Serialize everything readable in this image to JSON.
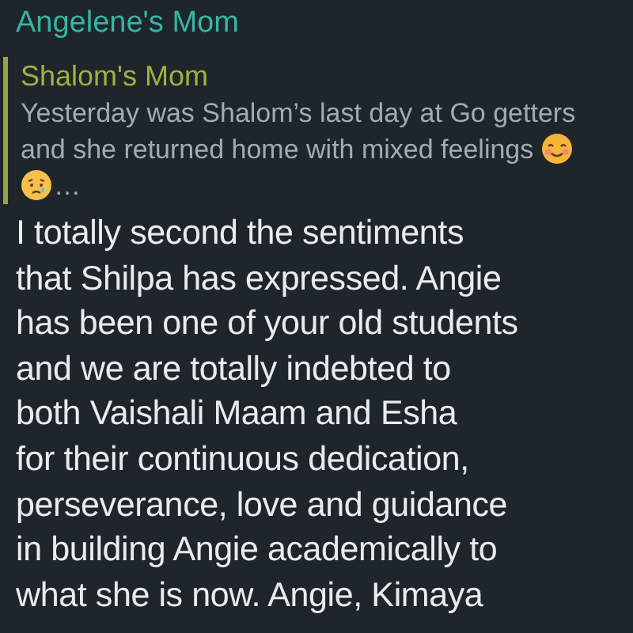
{
  "message": {
    "sender": "Angelene's Mom",
    "reply": {
      "sender": "Shalom's Mom",
      "text": "Yesterday was Shalom’s last day at Go getters and she returned home with mixed feelings",
      "ellipsis": "…"
    },
    "text": "I totally second the sentiments\nthat Shilpa has expressed.  Angie\nhas been one of your old students\nand we are totally indebted to\nboth Vaishali Maam and Esha\nfor their continuous dedication,\nperseverance, love and guidance\nin building Angie academically to\nwhat she is now. Angie, Kimaya"
  }
}
